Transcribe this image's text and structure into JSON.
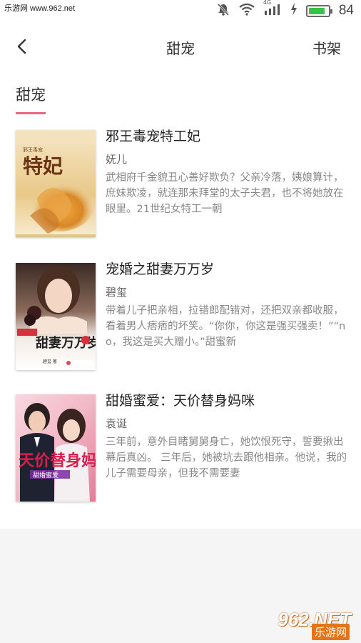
{
  "statusbar": {
    "watermark_text": "乐游网 www.962.net",
    "network_label": "4G",
    "battery_level": 84,
    "battery_text": "84",
    "icons": [
      "mute-icon",
      "wifi-icon",
      "signal-icon",
      "charging-icon",
      "battery-icon"
    ]
  },
  "header": {
    "back_icon": "chevron-left-icon",
    "title": "甜宠",
    "shelf_label": "书架"
  },
  "section": {
    "title": "甜宠",
    "accent_color": "#e8687a"
  },
  "books": [
    {
      "title": "邪王毒宠特工妃",
      "author": "妩儿",
      "description": "武相府千金貌丑心善好欺负？父亲冷落，姨娘算计，庶妹欺凌，就连那未拜堂的太子夫君，也不将她放在眼里。21世纪女特工一朝",
      "cover_text": "特妃",
      "cover_small": "邪王毒宠"
    },
    {
      "title": "宠婚之甜妻万万岁",
      "author": "碧玺",
      "description": "带着儿子把亲相，拉错郎配错对，还把双亲都收服，看着男人痞痞的坏笑。“你你，你这是强买强卖！”“no，我这是买大赠小。”甜蜜新",
      "cover_text": "甜妻万万岁",
      "cover_small": "碧玺 著"
    },
    {
      "title": "甜婚蜜爱：天价替身妈咪",
      "author": "袁诞",
      "description": "三年前，意外目睹舅舅身亡，她饮恨死守，誓要揪出幕后真凶。 三年后，她被坑去跟他相亲。他说，我的儿子需要母亲，但我不需要妻",
      "cover_text": "天价替身妈咪",
      "cover_small": "甜婚蜜爱"
    }
  ],
  "watermark": {
    "number": "962.NET",
    "text": "乐游网"
  }
}
